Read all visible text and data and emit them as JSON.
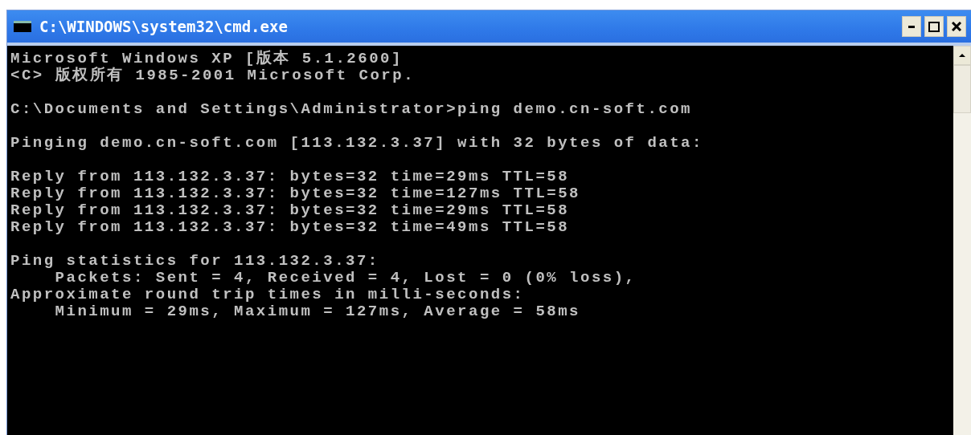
{
  "window": {
    "title": "C:\\WINDOWS\\system32\\cmd.exe",
    "buttons": [
      {
        "kind": "minimize"
      },
      {
        "kind": "maximize"
      },
      {
        "kind": "close"
      }
    ]
  },
  "console": {
    "blocks": [
      [
        "Microsoft Windows XP [版本 5.1.2600]",
        "<C> 版权所有 1985-2001 Microsoft Corp."
      ],
      [
        "C:\\Documents and Settings\\Administrator>ping demo.cn-soft.com"
      ],
      [
        "Pinging demo.cn-soft.com [113.132.3.37] with 32 bytes of data:"
      ],
      [
        "Reply from 113.132.3.37: bytes=32 time=29ms TTL=58",
        "Reply from 113.132.3.37: bytes=32 time=127ms TTL=58",
        "Reply from 113.132.3.37: bytes=32 time=29ms TTL=58",
        "Reply from 113.132.3.37: bytes=32 time=49ms TTL=58"
      ],
      [
        "Ping statistics for 113.132.3.37:",
        "    Packets: Sent = 4, Received = 4, Lost = 0 (0% loss),",
        "Approximate round trip times in milli-seconds:",
        "    Minimum = 29ms, Maximum = 127ms, Average = 58ms"
      ]
    ]
  }
}
